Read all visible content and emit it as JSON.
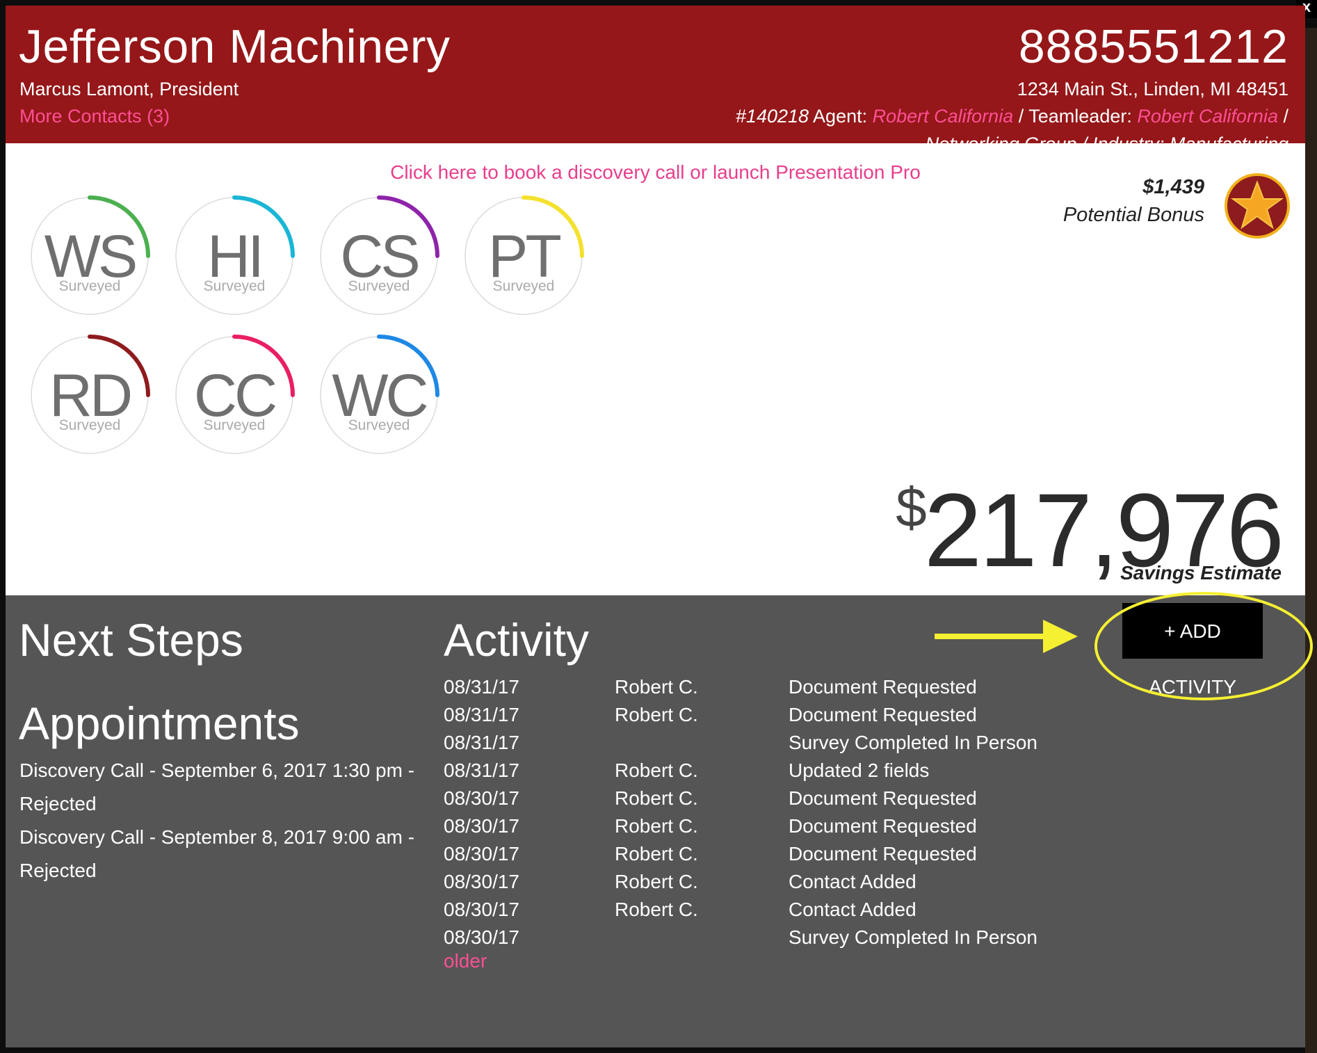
{
  "window": {
    "close_label": "x"
  },
  "header": {
    "company": "Jefferson Machinery",
    "contact": "Marcus Lamont, President",
    "more_contacts": "More Contacts (3)",
    "phone": "8885551212",
    "address": "1234 Main St., Linden, MI 48451",
    "id_label": "#140218",
    "agent_label": "Agent:",
    "agent_name": "Robert California",
    "separator": "/",
    "teamleader_label": "Teamleader:",
    "teamleader_name": "Robert California",
    "second_line": "Networking Group / Industry: Manufacturing"
  },
  "book_link": "Click here to book a discovery call or launch Presentation Pro",
  "bonus": {
    "amount": "$1,439",
    "label": "Potential Bonus",
    "icon": "star-badge-icon"
  },
  "gauges": [
    {
      "abbr": "WS",
      "sub": "Surveyed",
      "color": "#4caf50"
    },
    {
      "abbr": "HI",
      "sub": "Surveyed",
      "color": "#1ab6d6"
    },
    {
      "abbr": "CS",
      "sub": "Surveyed",
      "color": "#8e24aa"
    },
    {
      "abbr": "PT",
      "sub": "Surveyed",
      "color": "#f4e12d"
    },
    {
      "abbr": "RD",
      "sub": "Surveyed",
      "color": "#8e1b1e"
    },
    {
      "abbr": "CC",
      "sub": "Surveyed",
      "color": "#e91e63"
    },
    {
      "abbr": "WC",
      "sub": "Surveyed",
      "color": "#1e88e5"
    }
  ],
  "savings": {
    "currency": "$",
    "amount": "217,976",
    "label": "Savings Estimate"
  },
  "next_steps": {
    "title": "Next Steps",
    "appointments_title": "Appointments",
    "appointments": [
      "Discovery Call - September 6, 2017 1:30 pm - Rejected",
      "Discovery Call - September 8, 2017 9:00 am - Rejected"
    ]
  },
  "activity": {
    "title": "Activity",
    "add_label": "+ ADD ACTIVITY",
    "older_label": "older",
    "rows": [
      {
        "date": "08/31/17",
        "who": "Robert C.",
        "what": "Document Requested"
      },
      {
        "date": "08/31/17",
        "who": "Robert C.",
        "what": "Document Requested"
      },
      {
        "date": "08/31/17",
        "who": "",
        "what": "Survey Completed In Person"
      },
      {
        "date": "08/31/17",
        "who": "Robert C.",
        "what": "Updated 2 fields"
      },
      {
        "date": "08/30/17",
        "who": "Robert C.",
        "what": "Document Requested"
      },
      {
        "date": "08/30/17",
        "who": "Robert C.",
        "what": "Document Requested"
      },
      {
        "date": "08/30/17",
        "who": "Robert C.",
        "what": "Document Requested"
      },
      {
        "date": "08/30/17",
        "who": "Robert C.",
        "what": "Contact Added"
      },
      {
        "date": "08/30/17",
        "who": "Robert C.",
        "what": "Contact Added"
      },
      {
        "date": "08/30/17",
        "who": "",
        "what": "Survey Completed In Person"
      }
    ]
  },
  "colors": {
    "header_bg": "#951719",
    "accent_pink": "#ff4f95",
    "panel_bg": "#555555",
    "annotation": "#f5f032"
  }
}
